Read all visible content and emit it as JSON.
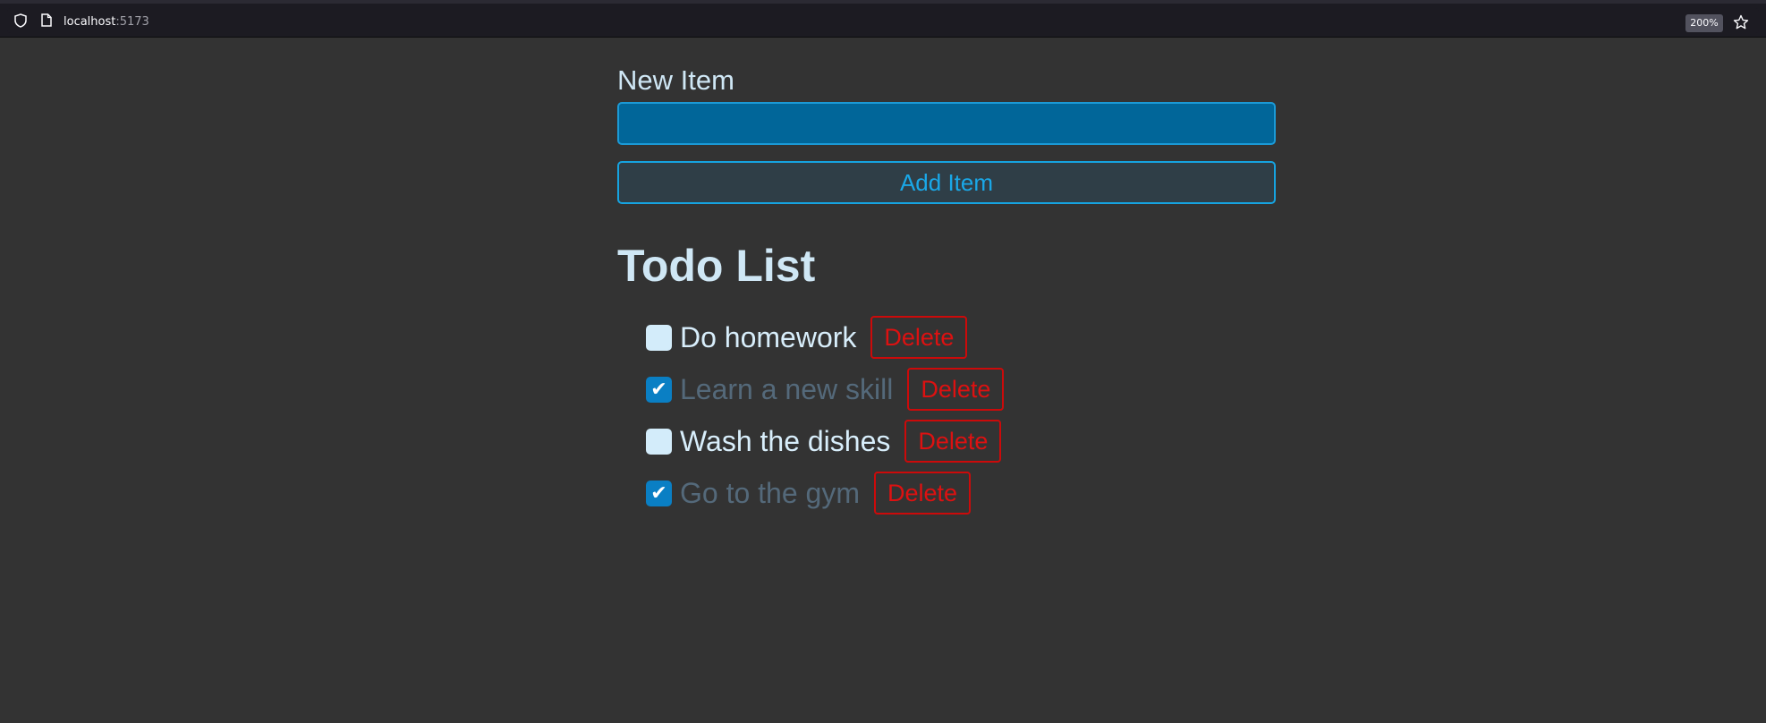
{
  "browser": {
    "url_host": "localhost",
    "url_port": ":5173",
    "zoom": "200%"
  },
  "form": {
    "label": "New Item",
    "input_value": "",
    "add_button_label": "Add Item"
  },
  "list": {
    "title": "Todo List",
    "items": [
      {
        "text": "Do homework",
        "checked": false,
        "delete_label": "Delete"
      },
      {
        "text": "Learn a new skill",
        "checked": true,
        "delete_label": "Delete"
      },
      {
        "text": "Wash the dishes",
        "checked": false,
        "delete_label": "Delete"
      },
      {
        "text": "Go to the gym",
        "checked": true,
        "delete_label": "Delete"
      }
    ]
  },
  "icons": {
    "checkmark": "✔"
  },
  "colors": {
    "background": "#333333",
    "accent": "#16a3e0",
    "input_bg": "#016699",
    "delete": "#cc0a0a",
    "done_text": "#54697a"
  }
}
